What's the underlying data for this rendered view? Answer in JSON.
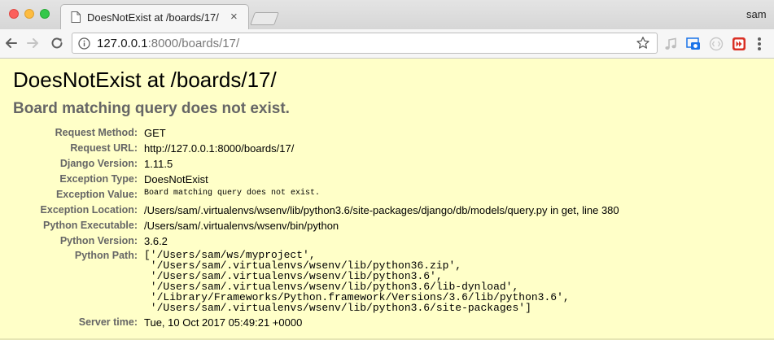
{
  "browser": {
    "tab_title": "DoesNotExist at /boards/17/",
    "tab_close": "×",
    "user": "sam",
    "url_host": "127.0.0.1",
    "url_rest": ":8000/boards/17/"
  },
  "error": {
    "title": "DoesNotExist at /boards/17/",
    "message": "Board matching query does not exist."
  },
  "meta": [
    {
      "label": "Request Method:",
      "value": "GET"
    },
    {
      "label": "Request URL:",
      "value": "http://127.0.0.1:8000/boards/17/"
    },
    {
      "label": "Django Version:",
      "value": "1.11.5"
    },
    {
      "label": "Exception Type:",
      "value": "DoesNotExist"
    },
    {
      "label": "Exception Value:",
      "value": "Board matching query does not exist."
    },
    {
      "label": "Exception Location:",
      "value": "/Users/sam/.virtualenvs/wsenv/lib/python3.6/site-packages/django/db/models/query.py in get, line 380"
    },
    {
      "label": "Python Executable:",
      "value": "/Users/sam/.virtualenvs/wsenv/bin/python"
    },
    {
      "label": "Python Version:",
      "value": "3.6.2"
    },
    {
      "label": "Python Path:",
      "lines": [
        "['/Users/sam/ws/myproject',",
        " '/Users/sam/.virtualenvs/wsenv/lib/python36.zip',",
        " '/Users/sam/.virtualenvs/wsenv/lib/python3.6',",
        " '/Users/sam/.virtualenvs/wsenv/lib/python3.6/lib-dynload',",
        " '/Library/Frameworks/Python.framework/Versions/3.6/lib/python3.6',",
        " '/Users/sam/.virtualenvs/wsenv/lib/python3.6/site-packages']"
      ]
    },
    {
      "label": "Server time:",
      "value": "Tue, 10 Oct 2017 05:49:21 +0000"
    }
  ],
  "icons": {
    "back": "back-arrow-icon",
    "forward": "forward-arrow-icon",
    "reload": "reload-icon",
    "site_info": "info-icon",
    "bookmark": "star-icon",
    "extensions": [
      "music-note-extension-icon",
      "screenshot-camera-extension-icon",
      "code-brackets-extension-icon",
      "media-skip-extension-icon"
    ],
    "menu": "more-vertical-icon"
  },
  "colors": {
    "page_background": "#ffffc8",
    "label_gray": "#666666",
    "close": "#fc605c",
    "minimize": "#fdbc40",
    "maximize": "#34c84a",
    "extension_red": "#d93025",
    "extension_blue": "#1a73e8"
  }
}
